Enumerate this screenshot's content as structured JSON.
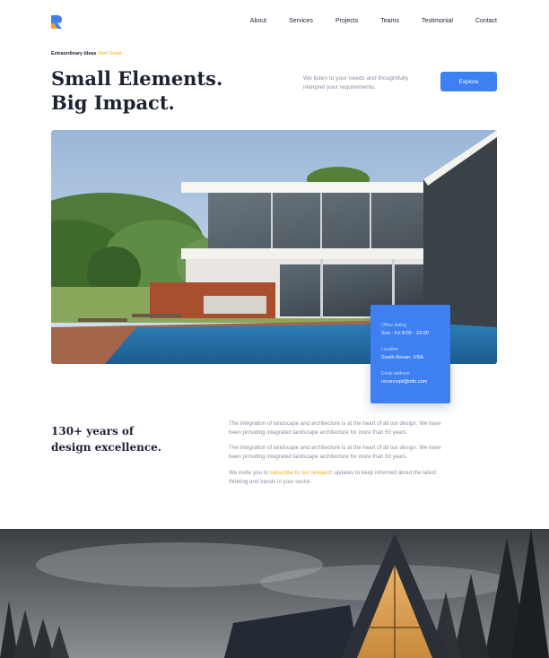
{
  "nav": {
    "items": [
      {
        "label": "About"
      },
      {
        "label": "Services"
      },
      {
        "label": "Projects"
      },
      {
        "label": "Teams"
      },
      {
        "label": "Testimonial"
      },
      {
        "label": "Contact"
      }
    ]
  },
  "hero": {
    "eyebrow": "Extraordinary Ideas",
    "eyebrow_accent": "Start Small",
    "title_line1": "Small Elements.",
    "title_line2": "Big Impact.",
    "description": "We listen to your needs and thoughtfully interpret your requirements.",
    "cta_label": "Explore"
  },
  "info_card": {
    "office_label": "Office dating",
    "office_value": "Sun - Fri 8:00 - 22:00",
    "location_label": "Location",
    "location_value": "South Revan, USA",
    "email_label": "Email address",
    "email_value": "reconcept@info.com"
  },
  "about": {
    "title_line1": "130+ years of",
    "title_line2": "design excellence.",
    "para1": "The integration of landscape and architecture is at the heart of all our design. We have been providing integrated landscape architecture for more than 50 years.",
    "para2": "The integration of landscape and architecture is at the heart of all our design. We have been providing integrated landscape architecture for more than 50 years.",
    "para3_before": "We invite you to ",
    "para3_link": "subscribe to our research",
    "para3_after": " updates to keep informed about the latest thinking and trends in your sector."
  },
  "colors": {
    "accent_blue": "#3e7ff2",
    "accent_orange": "#f0a81f",
    "text_dark": "#1d2233",
    "text_muted": "#8a8fa0"
  }
}
